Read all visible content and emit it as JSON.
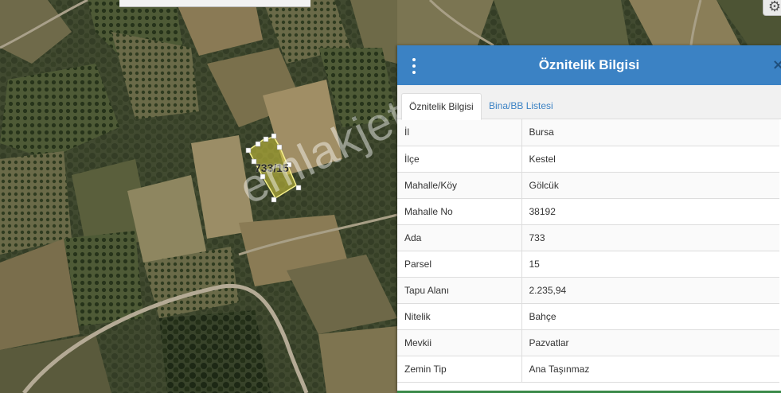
{
  "map": {
    "parcel_label": "733/15",
    "watermark": "emlakjet.com"
  },
  "toolbar": {
    "gear_icon": "gear-icon"
  },
  "panel": {
    "title": "Öznitelik Bilgisi",
    "menu_icon": "vertical-dots-icon",
    "close_icon": "close-icon",
    "header_color": "#3b82c4",
    "tabs": [
      {
        "label": "Öznitelik Bilgisi",
        "active": true
      },
      {
        "label": "Bina/BB Listesi",
        "active": false
      }
    ],
    "rows": [
      {
        "key": "İl",
        "value": "Bursa"
      },
      {
        "key": "İlçe",
        "value": "Kestel"
      },
      {
        "key": "Mahalle/Köy",
        "value": "Gölcük"
      },
      {
        "key": "Mahalle No",
        "value": "38192"
      },
      {
        "key": "Ada",
        "value": "733"
      },
      {
        "key": "Parsel",
        "value": "15"
      },
      {
        "key": "Tapu Alanı",
        "value": "2.235,94"
      },
      {
        "key": "Nitelik",
        "value": "Bahçe"
      },
      {
        "key": "Mevkii",
        "value": "Pazvatlar"
      },
      {
        "key": "Zemin Tip",
        "value": "Ana Taşınmaz"
      }
    ]
  }
}
